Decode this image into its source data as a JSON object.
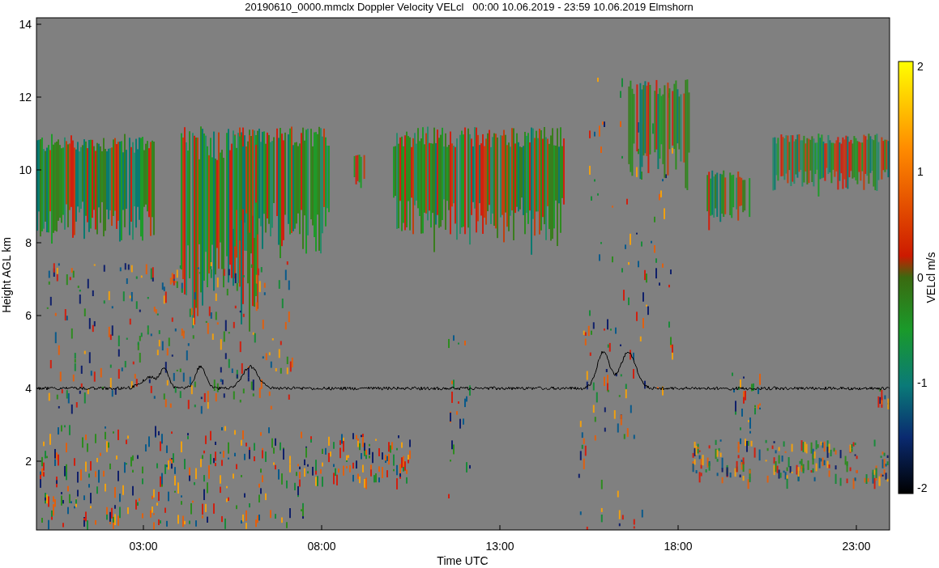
{
  "title": "20190610_0000.mmclx Doppler Velocity VELcl   00:00 10.06.2019 - 23:59 10.06.2019 Elmshorn",
  "y_axis": {
    "label": "Height AGL km",
    "ticks": [
      "14",
      "12",
      "10",
      "8",
      "6",
      "4",
      "2"
    ]
  },
  "x_axis": {
    "label": "Time UTC",
    "ticks": [
      "03:00",
      "08:00",
      "13:00",
      "18:00",
      "23:00"
    ]
  },
  "colorbar": {
    "label": "VELcl m/s",
    "ticks": [
      "2",
      "1",
      "0",
      "-1",
      "-2"
    ]
  }
}
